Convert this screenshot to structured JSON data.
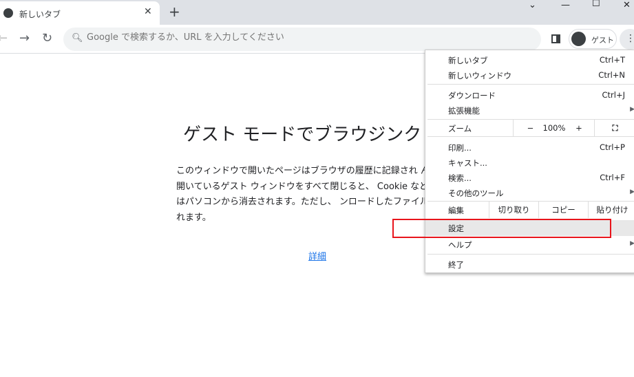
{
  "tab": {
    "title": "新しいタブ"
  },
  "window": {
    "minimize": "—",
    "maximize": "☐",
    "close": "✕"
  },
  "omnibox": {
    "placeholder": "Google で検索するか、URL を入力してください"
  },
  "profile": {
    "name": "ゲスト"
  },
  "content": {
    "heading": "ゲスト モードでブラウジンク",
    "body": "このウィンドウで開いたページはブラウザの履歴に記録され ん。また、開いているゲスト ウィンドウをすべて閉じると、 Cookie などのデータはパソコンから消去されます。ただし、 ンロードしたファイルは保持されます。",
    "link": "詳細"
  },
  "menu": {
    "new_tab": {
      "label": "新しいタブ",
      "shortcut": "Ctrl+T"
    },
    "new_window": {
      "label": "新しいウィンドウ",
      "shortcut": "Ctrl+N"
    },
    "downloads": {
      "label": "ダウンロード",
      "shortcut": "Ctrl+J"
    },
    "extensions": {
      "label": "拡張機能"
    },
    "zoom": {
      "label": "ズーム",
      "minus": "−",
      "value": "100%",
      "plus": "+"
    },
    "print": {
      "label": "印刷...",
      "shortcut": "Ctrl+P"
    },
    "cast": {
      "label": "キャスト..."
    },
    "find": {
      "label": "検索...",
      "shortcut": "Ctrl+F"
    },
    "more_tools": {
      "label": "その他のツール"
    },
    "edit": {
      "label": "編集",
      "cut": "切り取り",
      "copy": "コピー",
      "paste": "貼り付け"
    },
    "settings": {
      "label": "設定"
    },
    "help": {
      "label": "ヘルプ"
    },
    "exit": {
      "label": "終了"
    }
  },
  "colors": {
    "highlight": "#e8141b",
    "link": "#1a73e8"
  }
}
